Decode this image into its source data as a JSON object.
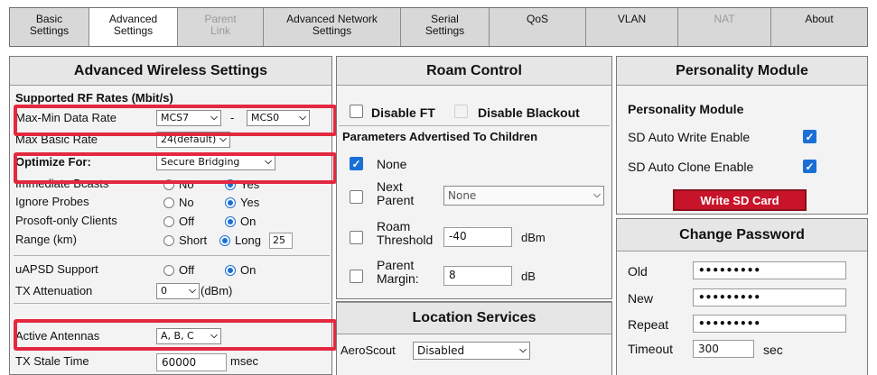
{
  "tabs": [
    {
      "line1": "Basic",
      "line2": "Settings"
    },
    {
      "line1": "Advanced",
      "line2": "Settings"
    },
    {
      "line1": "Parent",
      "line2": "Link"
    },
    {
      "line1": "Advanced Network",
      "line2": "Settings"
    },
    {
      "line1": "Serial",
      "line2": "Settings"
    },
    {
      "line1": "QoS",
      "line2": ""
    },
    {
      "line1": "VLAN",
      "line2": ""
    },
    {
      "line1": "NAT",
      "line2": ""
    },
    {
      "line1": "About",
      "line2": ""
    }
  ],
  "advanced_wireless": {
    "title": "Advanced Wireless Settings",
    "rf_rates_heading": "Supported RF Rates (Mbit/s)",
    "max_min_label": "Max-Min Data Rate",
    "max_rate": "MCS7",
    "dash": "-",
    "min_rate": "MCS0",
    "max_basic_label": "Max Basic Rate",
    "max_basic_value": "24(default)",
    "optimize_label": "Optimize For:",
    "optimize_value": "Secure Bridging",
    "immediate_label": "Immediate Bcasts",
    "ignore_label": "Ignore Probes",
    "prosoft_label": "Prosoft-only Clients",
    "range_label": "Range (km)",
    "no": "No",
    "yes": "Yes",
    "off": "Off",
    "on": "On",
    "short": "Short",
    "long": "Long",
    "range_value": "25",
    "uapsd_label": "uAPSD Support",
    "tx_att_label": "TX Attenuation",
    "tx_att_value": "0",
    "dbm_unit": "(dBm)",
    "antennas_label": "Active Antennas",
    "antennas_value": "A, B, C",
    "stale_label": "TX Stale Time",
    "stale_value": "60000",
    "msec_unit": "msec"
  },
  "roam_control": {
    "title": "Roam Control",
    "disable_ft": "Disable FT",
    "disable_blackout": "Disable Blackout",
    "params_heading": "Parameters Advertised To Children",
    "none_label": "None",
    "next_parent_l1": "Next",
    "next_parent_l2": "Parent",
    "next_parent_value": "None",
    "roam_l1": "Roam",
    "roam_l2": "Threshold",
    "roam_value": "-40",
    "roam_unit": "dBm",
    "margin_l1": "Parent",
    "margin_l2": "Margin:",
    "margin_value": "8",
    "margin_unit": "dB"
  },
  "location_services": {
    "title": "Location Services",
    "aeroscout_label": "AeroScout",
    "aeroscout_value": "Disabled"
  },
  "personality": {
    "title": "Personality Module",
    "subheading": "Personality Module",
    "auto_write": "SD Auto Write Enable",
    "auto_clone": "SD Auto Clone Enable",
    "write_button": "Write SD Card"
  },
  "change_password": {
    "title": "Change Password",
    "old_label": "Old",
    "new_label": "New",
    "repeat_label": "Repeat",
    "old_value": "•••••••••",
    "new_value": "•••••••••",
    "repeat_value": "•••••••••",
    "timeout_label": "Timeout",
    "timeout_value": "300",
    "sec_unit": "sec"
  },
  "colors": {
    "highlight": "#e3283f",
    "checkbox_blue": "#1a6fd6",
    "button_red": "#c8142a"
  },
  "icons": [
    "chevron-down-icon",
    "checkmark-icon"
  ]
}
